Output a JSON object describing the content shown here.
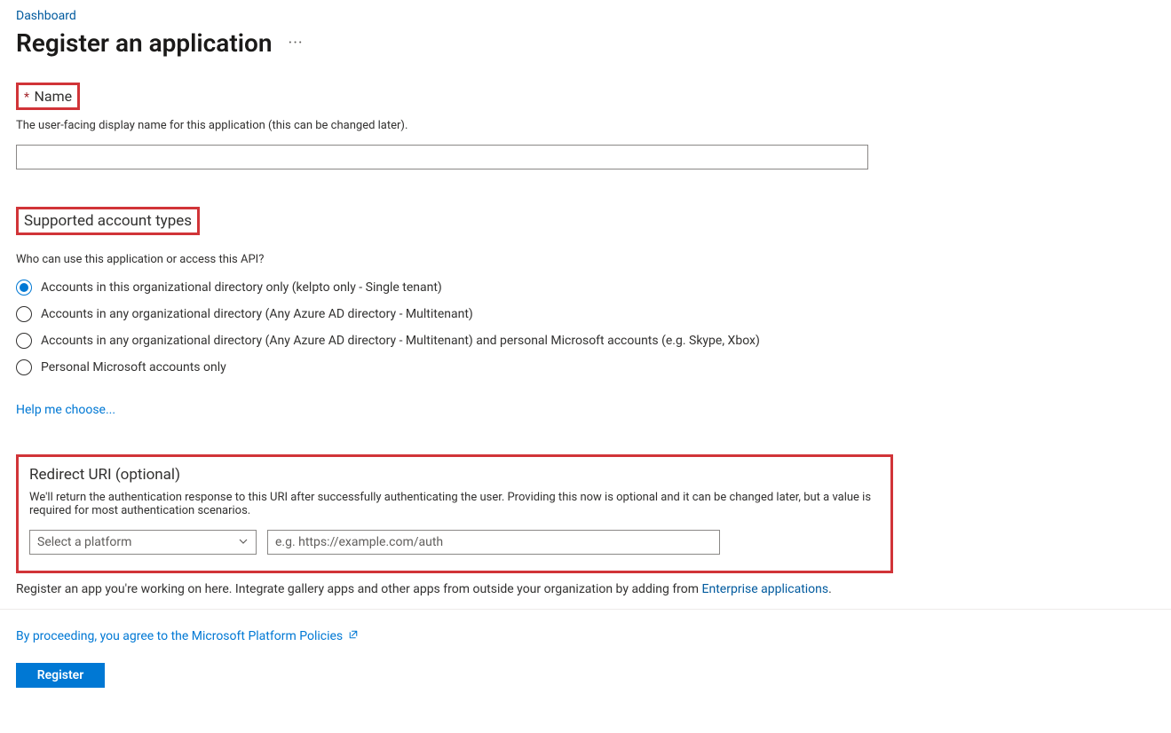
{
  "breadcrumb": {
    "dashboard": "Dashboard"
  },
  "page": {
    "title": "Register an application",
    "more": "···"
  },
  "name_section": {
    "required_mark": "*",
    "label": "Name",
    "help": "The user-facing display name for this application (this can be changed later).",
    "value": ""
  },
  "account_types": {
    "heading": "Supported account types",
    "question": "Who can use this application or access this API?",
    "options": [
      "Accounts in this organizational directory only (kelpto only - Single tenant)",
      "Accounts in any organizational directory (Any Azure AD directory - Multitenant)",
      "Accounts in any organizational directory (Any Azure AD directory - Multitenant) and personal Microsoft accounts (e.g. Skype, Xbox)",
      "Personal Microsoft accounts only"
    ],
    "selected_index": 0,
    "help_link": "Help me choose..."
  },
  "redirect": {
    "heading": "Redirect URI (optional)",
    "description": "We'll return the authentication response to this URI after successfully authenticating the user. Providing this now is optional and it can be changed later, but a value is required for most authentication scenarios.",
    "platform_placeholder": "Select a platform",
    "uri_placeholder": "e.g. https://example.com/auth"
  },
  "footnote": {
    "text_before": "Register an app you're working on here. Integrate gallery apps and other apps from outside your organization by adding from ",
    "link": "Enterprise applications",
    "text_after": "."
  },
  "policy": {
    "text": "By proceeding, you agree to the Microsoft Platform Policies "
  },
  "actions": {
    "register": "Register"
  }
}
